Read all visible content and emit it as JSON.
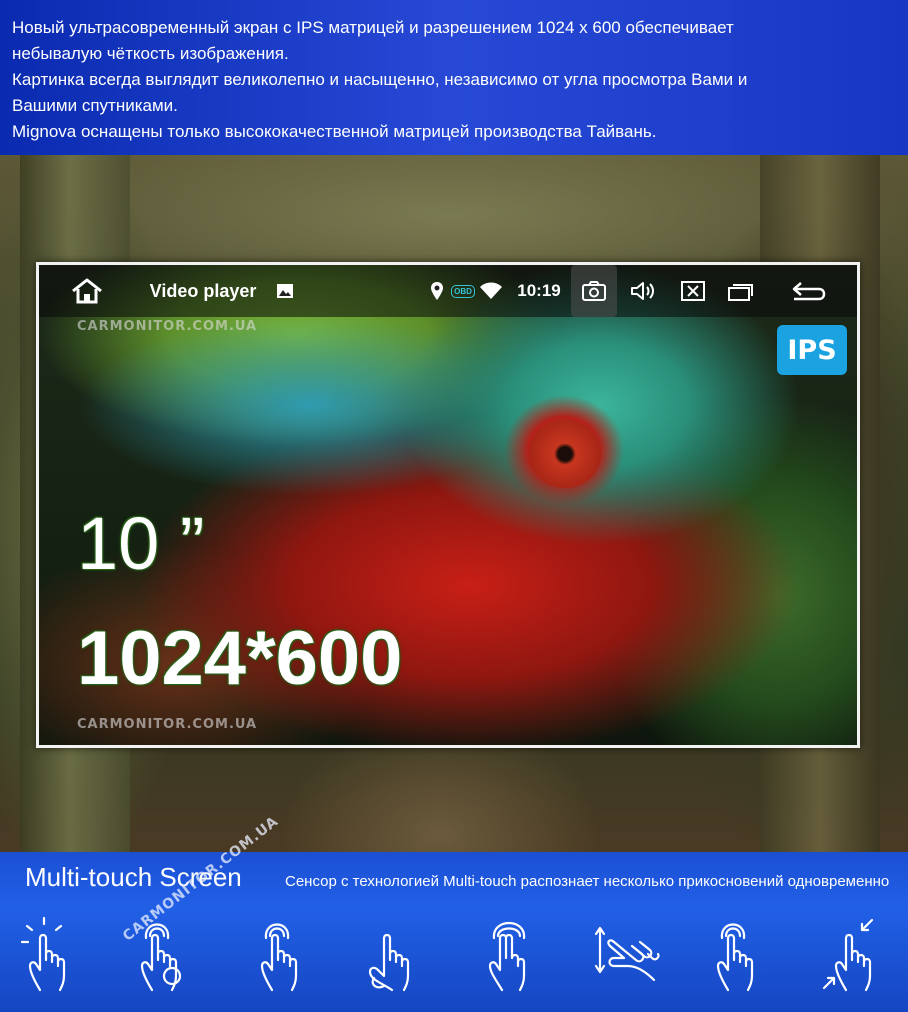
{
  "banner": {
    "lines": [
      "Новый ультрасовременный экран с IPS матрицей и разрешением 1024 х 600 обеспечивает",
      "небывалую чёткость изображения.",
      "Картинка всегда выглядит великолепно и насыщенно, независимо от угла просмотра Вами и",
      "Вашими спутниками.",
      "Mignova оснащены только высококачественной матрицей производства Тайвань."
    ]
  },
  "screen": {
    "statusbar": {
      "home_icon": "home-icon",
      "title": "Video player",
      "image_icon": "image-icon",
      "location_icon": "location-pin-icon",
      "obd_label": "OBD",
      "wifi_icon": "wifi-icon",
      "time": "10:19",
      "camera_icon": "camera-icon",
      "volume_icon": "volume-icon",
      "close_icon": "close-icon",
      "windows_icon": "recent-apps-icon",
      "back_icon": "back-arrow-icon"
    },
    "watermark": "CARMONITOR.COM.UA",
    "ips_badge": "IPS",
    "size_label": "10 ”",
    "resolution_label": "1024*600"
  },
  "multitouch": {
    "title": "Multi-touch Screen",
    "description": "Сенсор с технологией Multi-touch  распознает несколько прикосновений одновременно",
    "watermark": "CARMONITOR.COM.UA",
    "gestures": [
      "tap-gesture-icon",
      "double-tap-gesture-icon",
      "press-gesture-icon",
      "rotate-gesture-icon",
      "two-finger-gesture-icon",
      "scroll-gesture-icon",
      "swipe-gesture-icon",
      "pinch-gesture-icon"
    ]
  },
  "colors": {
    "banner_blue": "#1f3fcf",
    "panel_blue": "#2160e6",
    "ips_badge": "#1aa3e0"
  }
}
